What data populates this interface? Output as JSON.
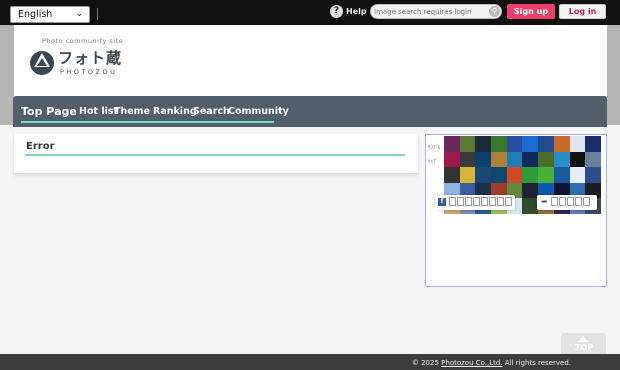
{
  "topbar": {
    "language": "English",
    "help_label": "Help",
    "search_placeholder": "Image search requires login",
    "signup_label": "Sign up",
    "login_label": "Log in"
  },
  "header": {
    "tagline": "Photo community site",
    "logo_text": "フォト蔵",
    "logo_sub": "PHOTOZOU"
  },
  "nav": {
    "items": [
      "Top Page",
      "Hot list",
      "Theme",
      "Ranking",
      "Search",
      "Community"
    ]
  },
  "main": {
    "error_title": "Error"
  },
  "sidebar": {
    "labels": [
      "ｻﾝﾌﾟﾙ",
      "ﾄｯﾌﾟ"
    ],
    "mosaic_colors": [
      "#6a2a5c",
      "#5d7a35",
      "#1e2c3a",
      "#3a7a2b",
      "#2a4ea0",
      "#1b6bd1",
      "#214a8f",
      "#c76b2b",
      "#e0e4ec",
      "#1d2f6b",
      "#9c1a4e",
      "#3a3a3a",
      "#0d3f6e",
      "#b0813a",
      "#1f7fb3",
      "#0e2a5a",
      "#4a6b2a",
      "#2a8cc8",
      "#111",
      "#6b7f99",
      "#333",
      "#d9b33a",
      "#1a4a73",
      "#11466d",
      "#d24a2a",
      "#2d9e3a",
      "#4bb03a",
      "#185b9e",
      "#e8eef6",
      "#2c4e88",
      "#8cb5e0",
      "#3a5fa0",
      "#1c2f4e",
      "#a23c2a",
      "#5f8b3a",
      "#223",
      "#0a58b0",
      "#113",
      "#2f6cb2",
      "#1d1d1d",
      "#c9a46b",
      "#7a8fa6",
      "#2a5a8c",
      "#9ab85a",
      "#d7e3ee",
      "#304a2a",
      "#8d6b3a",
      "#2a2a4a",
      "#5b7db3",
      "#3a4a5a"
    ]
  },
  "footer": {
    "prefix": "© 2025",
    "link": "Photozou Co.,Ltd.",
    "suffix": "All rights reserved."
  },
  "top_button": {
    "label": "TOP"
  },
  "colors": {
    "nav_bg": "#525e6a",
    "accent": "#6de0c8",
    "signup": "#e9416b",
    "login_text": "#c4244a"
  }
}
